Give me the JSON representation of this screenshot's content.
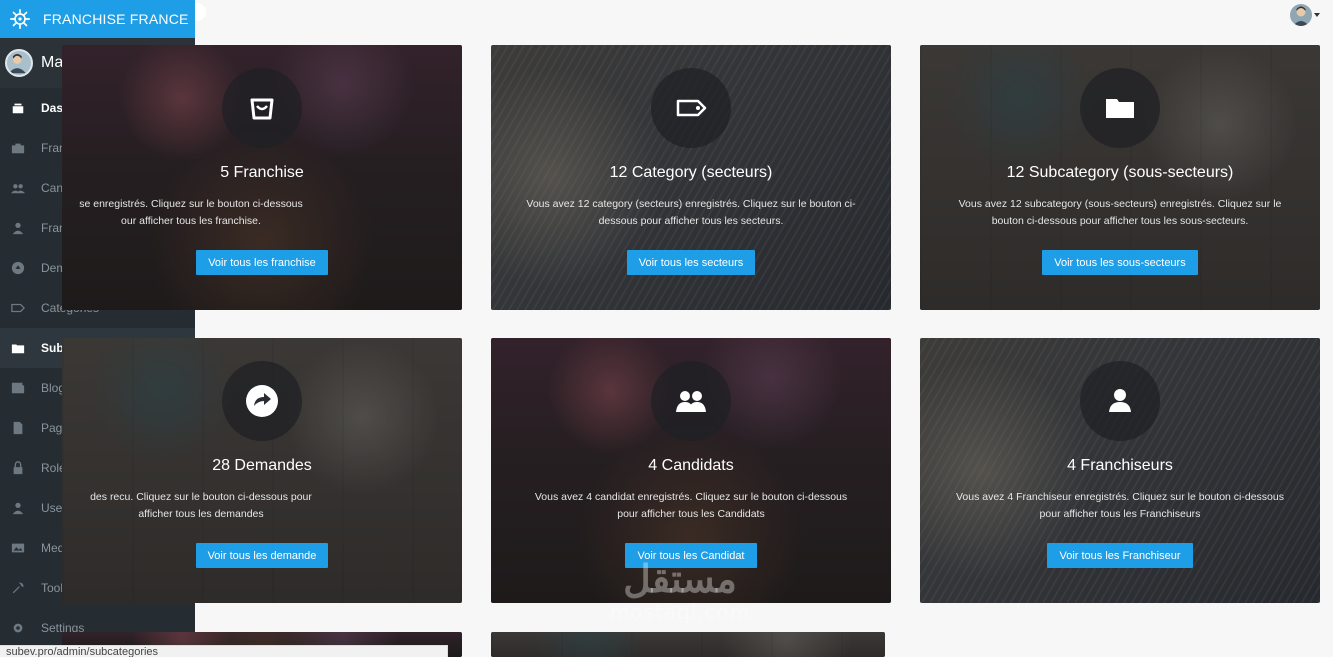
{
  "brand": {
    "name": "FRANCHISE FRANCE",
    "icon": "ship-wheel-icon",
    "color": "#1e9ee6"
  },
  "user": {
    "name": "Marouane"
  },
  "sidebar": {
    "items": [
      {
        "label": "Dashboard",
        "icon": "dashboard-icon",
        "active": true
      },
      {
        "label": "Franchises",
        "icon": "briefcase-icon"
      },
      {
        "label": "Candidats",
        "icon": "users-icon"
      },
      {
        "label": "Franchiseurs",
        "icon": "user-icon"
      },
      {
        "label": "Demandes",
        "icon": "arrow-circle-icon"
      },
      {
        "label": "Categories",
        "icon": "tag-icon"
      },
      {
        "label": "Subcategories",
        "icon": "folder-icon",
        "active": true
      },
      {
        "label": "Blogs",
        "icon": "newspaper-icon"
      },
      {
        "label": "Pages",
        "icon": "document-icon"
      },
      {
        "label": "Roles",
        "icon": "lock-icon"
      },
      {
        "label": "Users",
        "icon": "user-icon"
      },
      {
        "label": "Media",
        "icon": "image-icon"
      },
      {
        "label": "Tools",
        "icon": "wrench-icon"
      },
      {
        "label": "Settings",
        "icon": "gear-icon"
      }
    ]
  },
  "status_url": "subev.pro/admin/subcategories",
  "cards": [
    {
      "title": "5 Franchise",
      "desc_line1": "se enregistrés. Cliquez sur le bouton ci-dessous",
      "desc_line2": "our afficher tous les franchise.",
      "button": "Voir tous les franchise",
      "icon": "shopping-bag-icon"
    },
    {
      "title": "12 Category (secteurs)",
      "desc_line1": "Vous avez 12 category (secteurs) enregistrés. Cliquez sur le bouton ci-",
      "desc_line2": "dessous pour afficher tous les secteurs.",
      "button": "Voir tous les secteurs",
      "icon": "tag-icon"
    },
    {
      "title": "12 Subcategory (sous-secteurs)",
      "desc_line1": "Vous avez 12 subcategory (sous-secteurs) enregistrés. Cliquez sur le",
      "desc_line2": "bouton ci-dessous pour afficher tous les sous-secteurs.",
      "button": "Voir tous les sous-secteurs",
      "icon": "folder-icon"
    },
    {
      "title": "28 Demandes",
      "desc_line1": "des recu. Cliquez sur le bouton ci-dessous pour",
      "desc_line2": "afficher tous les demandes",
      "button": "Voir tous les demande",
      "icon": "share-arrow-icon"
    },
    {
      "title": "4 Candidats",
      "desc_line1": "Vous avez 4 candidat enregistrés. Cliquez sur le bouton ci-dessous",
      "desc_line2": "pour afficher tous les Candidats",
      "button": "Voir tous les Candidat",
      "icon": "users-icon"
    },
    {
      "title": "4 Franchiseurs",
      "desc_line1": "Vous avez 4 Franchiseur enregistrés. Cliquez sur le bouton ci-dessous",
      "desc_line2": "pour afficher tous les Franchiseurs",
      "button": "Voir tous les Franchiseur",
      "icon": "user-icon"
    }
  ],
  "watermark": {
    "arabic": "مستقل",
    "latin": "mostaql.com"
  }
}
